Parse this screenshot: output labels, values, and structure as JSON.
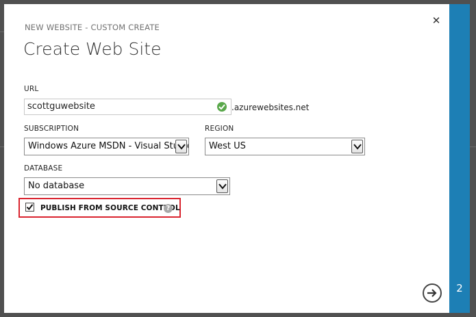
{
  "dialog": {
    "subtitle": "NEW WEBSITE - CUSTOM CREATE",
    "title": "Create Web Site",
    "close_glyph": "✕",
    "step_number": "2"
  },
  "url": {
    "label": "URL",
    "value": "scottguwebsite",
    "suffix": ".azurewebsites.net",
    "status_icon": "checkmark-icon",
    "status_color": "#5aa84b"
  },
  "subscription": {
    "label": "SUBSCRIPTION",
    "selected": "Windows Azure MSDN - Visual Studio"
  },
  "region": {
    "label": "REGION",
    "selected": "West US"
  },
  "database": {
    "label": "DATABASE",
    "selected": "No database"
  },
  "publish": {
    "label": "PUBLISH FROM SOURCE CONTROL",
    "checked": true,
    "help_glyph": "?",
    "highlight_color": "#d9232e"
  },
  "colors": {
    "accent": "#1d7fb5"
  }
}
